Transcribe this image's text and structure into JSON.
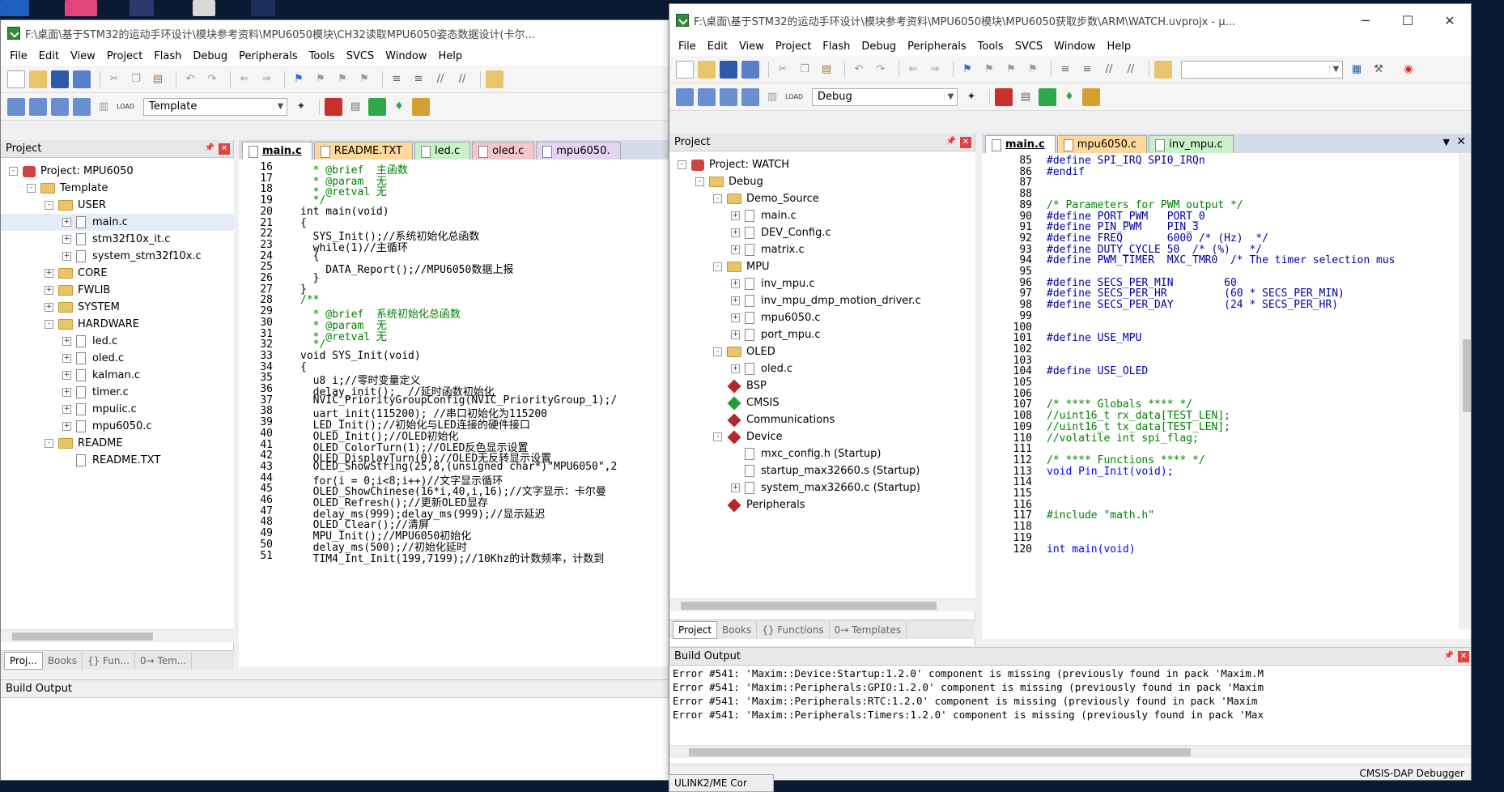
{
  "colors": {
    "comment": "#008000",
    "keyword": "#0000ff",
    "string": "#a000a0",
    "accent": "#2f8a3a"
  },
  "left_window": {
    "title": "F:\\桌面\\基于STM32的运动手环设计\\模块参考资料\\MPU6050模块\\CH32读取MPU6050姿态数据设计(卡尔...",
    "menu": [
      "File",
      "Edit",
      "View",
      "Project",
      "Flash",
      "Debug",
      "Peripherals",
      "Tools",
      "SVCS",
      "Window",
      "Help"
    ],
    "target_combo": "Template",
    "project_panel_title": "Project",
    "tree": [
      {
        "label": "Project: MPU6050",
        "depth": 0,
        "kind": "project",
        "exp": "-"
      },
      {
        "label": "Template",
        "depth": 1,
        "kind": "folder",
        "exp": "-"
      },
      {
        "label": "USER",
        "depth": 2,
        "kind": "folder",
        "exp": "-"
      },
      {
        "label": "main.c",
        "depth": 3,
        "kind": "file",
        "exp": "+"
      },
      {
        "label": "stm32f10x_it.c",
        "depth": 3,
        "kind": "file",
        "exp": "+"
      },
      {
        "label": "system_stm32f10x.c",
        "depth": 3,
        "kind": "file",
        "exp": "+"
      },
      {
        "label": "CORE",
        "depth": 2,
        "kind": "folder",
        "exp": "+"
      },
      {
        "label": "FWLIB",
        "depth": 2,
        "kind": "folder",
        "exp": "+"
      },
      {
        "label": "SYSTEM",
        "depth": 2,
        "kind": "folder",
        "exp": "+"
      },
      {
        "label": "HARDWARE",
        "depth": 2,
        "kind": "folder",
        "exp": "-"
      },
      {
        "label": "led.c",
        "depth": 3,
        "kind": "file",
        "exp": "+"
      },
      {
        "label": "oled.c",
        "depth": 3,
        "kind": "file",
        "exp": "+"
      },
      {
        "label": "kalman.c",
        "depth": 3,
        "kind": "file",
        "exp": "+"
      },
      {
        "label": "timer.c",
        "depth": 3,
        "kind": "file",
        "exp": "+"
      },
      {
        "label": "mpuiic.c",
        "depth": 3,
        "kind": "file",
        "exp": "+"
      },
      {
        "label": "mpu6050.c",
        "depth": 3,
        "kind": "file",
        "exp": "+"
      },
      {
        "label": "README",
        "depth": 2,
        "kind": "folder",
        "exp": "-"
      },
      {
        "label": "README.TXT",
        "depth": 3,
        "kind": "file",
        "exp": ""
      }
    ],
    "tabs": [
      {
        "label": "main.c",
        "bg": "#ffffff",
        "bold": true
      },
      {
        "label": "README.TXT",
        "bg": "#ffd99a",
        "bold": false
      },
      {
        "label": "led.c",
        "bg": "#c9f2c9",
        "bold": false
      },
      {
        "label": "oled.c",
        "bg": "#f5c6cc",
        "bold": false
      },
      {
        "label": "mpu6050.",
        "bg": "#e3d4f4",
        "bold": false
      }
    ],
    "bottom_tabs": [
      "Proj...",
      "Books",
      "{} Fun...",
      "0→ Tem..."
    ],
    "build_output_title": "Build Output",
    "code": [
      {
        "n": "16",
        "t": "  * @brief  主函数",
        "c": "cmt"
      },
      {
        "n": "17",
        "t": "  * @param  无",
        "c": "cmt"
      },
      {
        "n": "18",
        "t": "  * @retval 无",
        "c": "cmt"
      },
      {
        "n": "19",
        "t": "  */",
        "c": "cmt"
      },
      {
        "n": "20",
        "t": "int main(void)",
        "c": ""
      },
      {
        "n": "21",
        "t": "{",
        "c": ""
      },
      {
        "n": "22",
        "t": "  SYS_Init();//系统初始化总函数",
        "c": ""
      },
      {
        "n": "23",
        "t": "  while(1)//主循环",
        "c": ""
      },
      {
        "n": "24",
        "t": "  {",
        "c": ""
      },
      {
        "n": "25",
        "t": "    DATA_Report();//MPU6050数据上报",
        "c": ""
      },
      {
        "n": "26",
        "t": "  }",
        "c": ""
      },
      {
        "n": "27",
        "t": "}",
        "c": ""
      },
      {
        "n": "28",
        "t": "/**",
        "c": "cmt"
      },
      {
        "n": "29",
        "t": "  * @brief  系统初始化总函数",
        "c": "cmt"
      },
      {
        "n": "30",
        "t": "  * @param  无",
        "c": "cmt"
      },
      {
        "n": "31",
        "t": "  * @retval 无",
        "c": "cmt"
      },
      {
        "n": "32",
        "t": "  */",
        "c": "cmt"
      },
      {
        "n": "33",
        "t": "void SYS_Init(void)",
        "c": ""
      },
      {
        "n": "34",
        "t": "{",
        "c": ""
      },
      {
        "n": "35",
        "t": "  u8 i;//零时变量定义",
        "c": ""
      },
      {
        "n": "36",
        "t": "  delay_init();  //延时函数初始化",
        "c": ""
      },
      {
        "n": "37",
        "t": "  NVIC_PriorityGroupConfig(NVIC_PriorityGroup_1);/",
        "c": ""
      },
      {
        "n": "38",
        "t": "  uart_init(115200); //串口初始化为115200",
        "c": ""
      },
      {
        "n": "39",
        "t": "  LED_Init();//初始化与LED连接的硬件接口",
        "c": ""
      },
      {
        "n": "40",
        "t": "  OLED_Init();//OLED初始化",
        "c": ""
      },
      {
        "n": "41",
        "t": "  OLED_ColorTurn(1);//OLED反色显示设置",
        "c": ""
      },
      {
        "n": "42",
        "t": "  OLED_DisplayTurn(0);//OLED无反转显示设置",
        "c": ""
      },
      {
        "n": "43",
        "t": "  OLED_ShowString(25,8,(unsigned char*)\"MPU6050\",2",
        "c": ""
      },
      {
        "n": "44",
        "t": "  for(i = 0;i<8;i++)//文字显示循环",
        "c": ""
      },
      {
        "n": "45",
        "t": "  OLED_ShowChinese(16*i,40,i,16);//文字显示：卡尔曼",
        "c": ""
      },
      {
        "n": "46",
        "t": "  OLED_Refresh();//更新OLED显存",
        "c": ""
      },
      {
        "n": "47",
        "t": "  delay_ms(999);delay_ms(999);//显示延迟",
        "c": ""
      },
      {
        "n": "48",
        "t": "  OLED_Clear();//清屏",
        "c": ""
      },
      {
        "n": "49",
        "t": "  MPU_Init();//MPU6050初始化",
        "c": ""
      },
      {
        "n": "50",
        "t": "  delay_ms(500);//初始化延时",
        "c": ""
      },
      {
        "n": "51",
        "t": "  TIM4_Int_Init(199,7199);//10Khz的计数频率，计数到",
        "c": ""
      }
    ]
  },
  "right_window": {
    "title": "F:\\桌面\\基于STM32的运动手环设计\\模块参考资料\\MPU6050模块\\MPU6050获取步数\\ARM\\WATCH.uvprojx - µ...",
    "menu": [
      "File",
      "Edit",
      "View",
      "Project",
      "Flash",
      "Debug",
      "Peripherals",
      "Tools",
      "SVCS",
      "Window",
      "Help"
    ],
    "target_combo": "Debug",
    "project_panel_title": "Project",
    "tree": [
      {
        "label": "Project: WATCH",
        "depth": 0,
        "kind": "project",
        "exp": "-"
      },
      {
        "label": "Debug",
        "depth": 1,
        "kind": "folder",
        "exp": "-"
      },
      {
        "label": "Demo_Source",
        "depth": 2,
        "kind": "folder",
        "exp": "-"
      },
      {
        "label": "main.c",
        "depth": 3,
        "kind": "file",
        "exp": "+"
      },
      {
        "label": "DEV_Config.c",
        "depth": 3,
        "kind": "file",
        "exp": "+"
      },
      {
        "label": "matrix.c",
        "depth": 3,
        "kind": "file",
        "exp": "+"
      },
      {
        "label": "MPU",
        "depth": 2,
        "kind": "folder",
        "exp": "-"
      },
      {
        "label": "inv_mpu.c",
        "depth": 3,
        "kind": "file",
        "exp": "+"
      },
      {
        "label": "inv_mpu_dmp_motion_driver.c",
        "depth": 3,
        "kind": "file",
        "exp": "+"
      },
      {
        "label": "mpu6050.c",
        "depth": 3,
        "kind": "file",
        "exp": "+"
      },
      {
        "label": "port_mpu.c",
        "depth": 3,
        "kind": "file",
        "exp": "+"
      },
      {
        "label": "OLED",
        "depth": 2,
        "kind": "folder",
        "exp": "-"
      },
      {
        "label": "oled.c",
        "depth": 3,
        "kind": "file",
        "exp": "+"
      },
      {
        "label": "BSP",
        "depth": 2,
        "kind": "gem-red",
        "exp": ""
      },
      {
        "label": "CMSIS",
        "depth": 2,
        "kind": "gem-green",
        "exp": ""
      },
      {
        "label": "Communications",
        "depth": 2,
        "kind": "gem-red",
        "exp": ""
      },
      {
        "label": "Device",
        "depth": 2,
        "kind": "gem-red",
        "exp": "-"
      },
      {
        "label": "mxc_config.h (Startup)",
        "depth": 3,
        "kind": "file",
        "exp": ""
      },
      {
        "label": "startup_max32660.s (Startup)",
        "depth": 3,
        "kind": "file",
        "exp": ""
      },
      {
        "label": "system_max32660.c (Startup)",
        "depth": 3,
        "kind": "file",
        "exp": "+"
      },
      {
        "label": "Peripherals",
        "depth": 2,
        "kind": "gem-red",
        "exp": ""
      }
    ],
    "tabs": [
      {
        "label": "main.c",
        "bg": "#ffffff",
        "bold": true
      },
      {
        "label": "mpu6050.c",
        "bg": "#ffd99a",
        "bold": false
      },
      {
        "label": "inv_mpu.c",
        "bg": "#c9f2c9",
        "bold": false
      }
    ],
    "bottom_tabs": [
      "Project",
      "Books",
      "{} Functions",
      "0→ Templates"
    ],
    "build_output_title": "Build Output",
    "build_output": [
      "Error #541: 'Maxim::Device:Startup:1.2.0' component is missing (previously found in pack 'Maxim.M",
      "Error #541: 'Maxim::Peripherals:GPIO:1.2.0' component is missing (previously found in pack 'Maxim",
      "Error #541: 'Maxim::Peripherals:RTC:1.2.0' component is missing (previously found in pack 'Maxim",
      "Error #541: 'Maxim::Peripherals:Timers:1.2.0' component is missing (previously found in pack 'Max"
    ],
    "status_debugger": "CMSIS-DAP Debugger",
    "code": [
      {
        "n": "85",
        "t": "#define SPI_IRQ SPI0_IRQn",
        "c": "pp"
      },
      {
        "n": "86",
        "t": "#endif",
        "c": "pp"
      },
      {
        "n": "87",
        "t": "",
        "c": ""
      },
      {
        "n": "88",
        "t": "",
        "c": ""
      },
      {
        "n": "89",
        "t": "/* Parameters for PWM output */",
        "c": "cmt"
      },
      {
        "n": "90",
        "t": "#define PORT_PWM   PORT_0",
        "c": "pp"
      },
      {
        "n": "91",
        "t": "#define PIN_PWM    PIN_3",
        "c": "pp"
      },
      {
        "n": "92",
        "t": "#define FREQ       6000 /* (Hz)  */",
        "c": "pp"
      },
      {
        "n": "93",
        "t": "#define DUTY_CYCLE 50  /* (%)   */",
        "c": "pp"
      },
      {
        "n": "94",
        "t": "#define PWM_TIMER  MXC_TMR0  /* The timer selection mus",
        "c": "pp"
      },
      {
        "n": "95",
        "t": "",
        "c": ""
      },
      {
        "n": "96",
        "t": "#define SECS_PER_MIN        60",
        "c": "pp"
      },
      {
        "n": "97",
        "t": "#define SECS_PER_HR         (60 * SECS_PER_MIN)",
        "c": "pp"
      },
      {
        "n": "98",
        "t": "#define SECS_PER_DAY        (24 * SECS_PER_HR)",
        "c": "pp"
      },
      {
        "n": "99",
        "t": "",
        "c": ""
      },
      {
        "n": "100",
        "t": "",
        "c": ""
      },
      {
        "n": "101",
        "t": "#define USE_MPU",
        "c": "pp"
      },
      {
        "n": "102",
        "t": "",
        "c": ""
      },
      {
        "n": "103",
        "t": "",
        "c": ""
      },
      {
        "n": "104",
        "t": "#define USE_OLED",
        "c": "pp"
      },
      {
        "n": "105",
        "t": "",
        "c": ""
      },
      {
        "n": "106",
        "t": "",
        "c": ""
      },
      {
        "n": "107",
        "t": "/* **** Globals **** */",
        "c": "cmt"
      },
      {
        "n": "108",
        "t": "//uint16_t rx_data[TEST_LEN];",
        "c": "cmt"
      },
      {
        "n": "109",
        "t": "//uint16_t tx_data[TEST_LEN];",
        "c": "cmt"
      },
      {
        "n": "110",
        "t": "//volatile int spi_flag;",
        "c": "cmt"
      },
      {
        "n": "111",
        "t": "",
        "c": ""
      },
      {
        "n": "112",
        "t": "/* **** Functions **** */",
        "c": "cmt"
      },
      {
        "n": "113",
        "t": "void Pin_Init(void);",
        "c": "kw"
      },
      {
        "n": "114",
        "t": "",
        "c": ""
      },
      {
        "n": "115",
        "t": "",
        "c": ""
      },
      {
        "n": "116",
        "t": "",
        "c": ""
      },
      {
        "n": "117",
        "t": "#include \"math.h\"",
        "c": "cmt"
      },
      {
        "n": "118",
        "t": "",
        "c": ""
      },
      {
        "n": "119",
        "t": "",
        "c": ""
      },
      {
        "n": "120",
        "t": "int main(void)",
        "c": "kw"
      }
    ]
  },
  "taskbar": {
    "item": "ULINK2/ME Cor"
  }
}
